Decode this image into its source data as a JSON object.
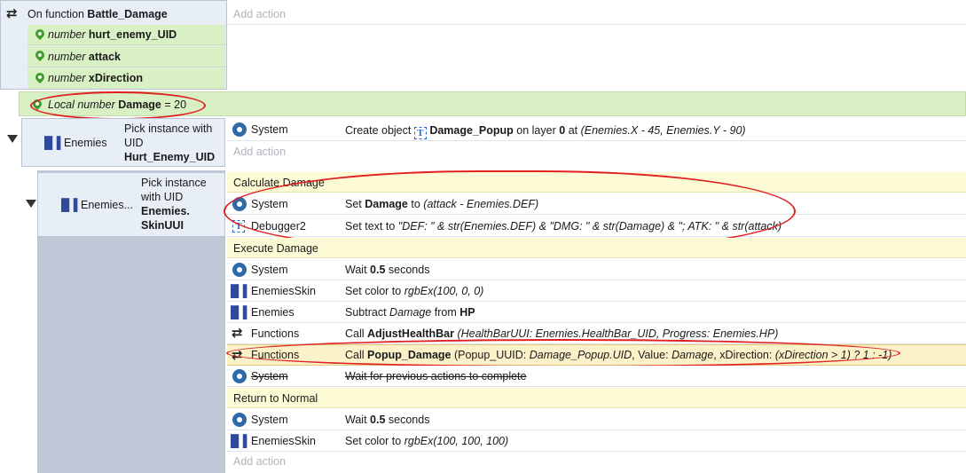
{
  "function_block": {
    "header_prefix": "On function",
    "header_name": "Battle_Damage",
    "add_action": "Add action",
    "params": [
      {
        "type": "number",
        "name": "hurt_enemy_UID"
      },
      {
        "type": "number",
        "name": "attack"
      },
      {
        "type": "number",
        "name": "xDirection"
      }
    ]
  },
  "local_var": {
    "prefix": "Local number",
    "name": "Damage",
    "value": "= 20"
  },
  "event1": {
    "object": "Enemies",
    "condition_line1": "Pick instance with",
    "condition_line2": "UID",
    "condition_param": "Hurt_Enemy_UID",
    "action_object": "System",
    "action_prefix": "Create object",
    "action_target": "Damage_Popup",
    "action_mid": "on layer",
    "action_layer": "0",
    "action_at": "at",
    "action_coords": "(Enemies.X - 45, Enemies.Y - 90)",
    "add_action": "Add action"
  },
  "event2": {
    "object": "Enemies...",
    "condition_line1": "Pick instance",
    "condition_line2": "with UID",
    "condition_param1": "Enemies.",
    "condition_param2": "SkinUUI"
  },
  "groups": [
    {
      "title": "Calculate Damage"
    },
    {
      "title": "Execute Damage"
    },
    {
      "title": "Return to Normal"
    }
  ],
  "calc_actions": [
    {
      "object": "System",
      "prefix": "Set",
      "target": "Damage",
      "mid": "to",
      "expr": "(attack - Enemies.DEF)"
    },
    {
      "object": "Debugger2",
      "prefix": "Set text to",
      "expr": "\"DEF: \" & str(Enemies.DEF) & \"DMG: \" & str(Damage) & \"; ATK: \" & str(attack)"
    }
  ],
  "exec_actions": {
    "a1": {
      "object": "System",
      "prefix": "Wait",
      "value": "0.5",
      "suffix": "seconds"
    },
    "a2": {
      "object": "EnemiesSkin",
      "prefix": "Set color to",
      "expr": "rgbEx(100, 0, 0)"
    },
    "a3": {
      "object": "Enemies",
      "prefix": "Subtract",
      "expr": "Damage",
      "mid": "from",
      "target": "HP"
    },
    "a4": {
      "object": "Functions",
      "prefix": "Call",
      "target": "AdjustHealthBar",
      "args": "(HealthBarUUI: Enemies.HealthBar_UID, Progress: Enemies.HP)"
    },
    "a5": {
      "object": "Functions",
      "prefix": "Call",
      "target": "Popup_Damage",
      "args_a": "(Popup_UUID:",
      "args_b": "Damage_Popup.UID",
      "args_c": ", Value:",
      "args_d": "Damage",
      "args_e": ", xDirection:",
      "args_f": "(xDirection > 1) ? 1 : -1)"
    },
    "a6": {
      "object": "System",
      "text": "Wait for previous actions to complete"
    }
  },
  "return_actions": [
    {
      "object": "System",
      "prefix": "Wait",
      "value": "0.5",
      "suffix": "seconds"
    },
    {
      "object": "EnemiesSkin",
      "prefix": "Set color to",
      "expr": "rgbEx(100, 100, 100)"
    }
  ],
  "final_add_action": "Add action",
  "colors": {
    "green_param": "#d9f0c4",
    "event_bg": "#e8eef6",
    "group_yellow": "#fdfbd6",
    "highlight_row": "#fcf2c9",
    "annotation": "#e02020"
  },
  "icons": {
    "function": "loop-arrows-icon",
    "param": "map-pin-icon",
    "system": "gear-icon",
    "sprite": "space-invader-icon",
    "text": "text-object-icon",
    "collapse": "triangle-down-icon"
  }
}
